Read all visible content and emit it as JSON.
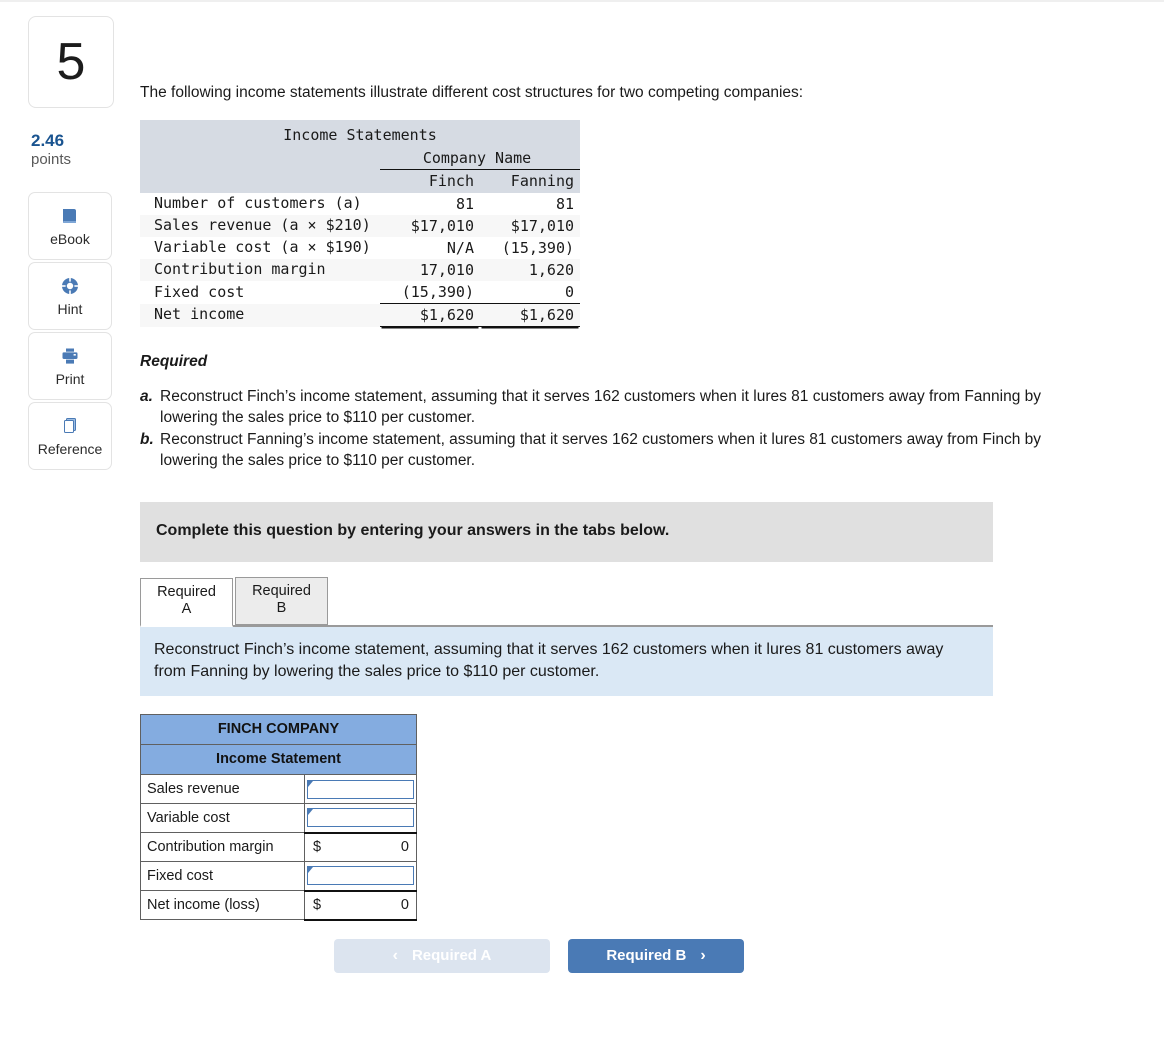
{
  "rail": {
    "question_number": "5",
    "points_value": "2.46",
    "points_label": "points",
    "tools": [
      {
        "icon": "book-icon",
        "label": "eBook"
      },
      {
        "icon": "lifebuoy-icon",
        "label": "Hint"
      },
      {
        "icon": "printer-icon",
        "label": "Print"
      },
      {
        "icon": "copy-pages-icon",
        "label": "Reference"
      }
    ]
  },
  "main": {
    "intro": "The following income statements illustrate different cost structures for two competing companies:"
  },
  "exhibit": {
    "title": "Income Statements",
    "group_header": "Company Name",
    "columns": [
      "Finch",
      "Fanning"
    ],
    "rows": [
      {
        "label": "Number of customers (a)",
        "finch": "81",
        "fanning": "81"
      },
      {
        "label": "Sales revenue (a × $210)",
        "finch": "$17,010",
        "fanning": "$17,010"
      },
      {
        "label": "Variable cost (a × $190)",
        "finch": "N/A",
        "fanning": "(15,390)"
      },
      {
        "label": "Contribution margin",
        "finch": "17,010",
        "fanning": "1,620"
      },
      {
        "label": "Fixed cost",
        "finch": "(15,390)",
        "fanning": "0"
      },
      {
        "label": "Net income",
        "finch": "$1,620",
        "fanning": "$1,620"
      }
    ]
  },
  "required": {
    "heading": "Required",
    "items": [
      {
        "marker": "a.",
        "text": "Reconstruct Finch’s income statement, assuming that it serves 162 customers when it lures 81 customers away from Fanning by lowering the sales price to $110 per customer."
      },
      {
        "marker": "b.",
        "text": "Reconstruct Fanning’s income statement, assuming that it serves 162 customers when it lures 81 customers away from Finch by lowering the sales price to $110 per customer."
      }
    ]
  },
  "banner": {
    "text": "Complete this question by entering your answers in the tabs below."
  },
  "tabs": [
    {
      "line1": "Required",
      "line2": "A",
      "active": true
    },
    {
      "line1": "Required",
      "line2": "B",
      "active": false
    }
  ],
  "prompt": {
    "text": "Reconstruct Finch’s income statement, assuming that it serves 162 customers when it lures 81 customers away from Fanning by lowering the sales price to $110 per customer."
  },
  "answer_table": {
    "company": "FINCH COMPANY",
    "subtitle": "Income Statement",
    "rows": [
      {
        "label": "Sales revenue",
        "type": "input",
        "value": ""
      },
      {
        "label": "Variable cost",
        "type": "input",
        "value": ""
      },
      {
        "label": "Contribution margin",
        "type": "calc",
        "dollar": "$",
        "amount": "0"
      },
      {
        "label": "Fixed cost",
        "type": "input",
        "value": ""
      },
      {
        "label": "Net income (loss)",
        "type": "calc",
        "dollar": "$",
        "amount": "0"
      }
    ]
  },
  "nav": {
    "prev_label": "Required A",
    "prev_chevron": "‹",
    "next_label": "Required B",
    "next_chevron": "›"
  },
  "colors": {
    "accent_blue": "#4a7ab5",
    "table_header_blue": "#84ace0",
    "prompt_blue": "#dae8f5",
    "banner_grey": "#e0e0e0",
    "exhibit_head_grey": "#d6dbe3",
    "points_blue": "#1a5490"
  }
}
